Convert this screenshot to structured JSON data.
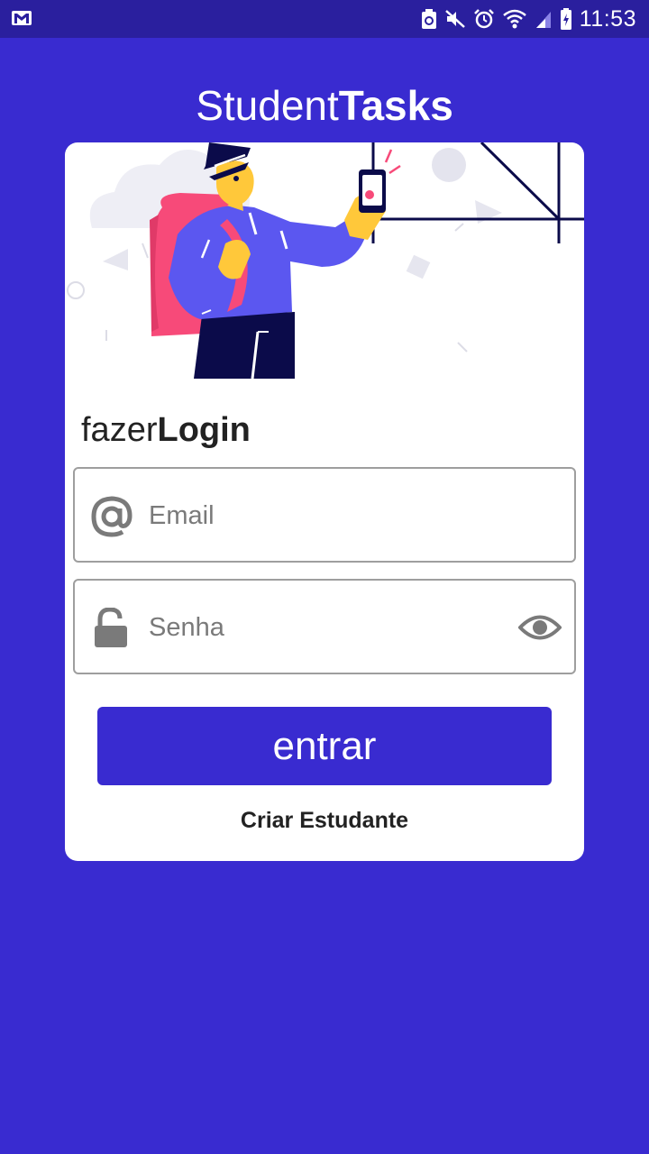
{
  "status_bar": {
    "time": "11:53",
    "left_icon": "gmail-icon",
    "right_icons": [
      "recycle-icon",
      "mute-icon",
      "alarm-icon",
      "wifi-icon",
      "signal-icon",
      "battery-icon"
    ]
  },
  "header": {
    "title_light": "Student",
    "title_bold": "Tasks"
  },
  "login": {
    "heading_light": "fazer",
    "heading_bold": "Login",
    "email": {
      "placeholder": "Email",
      "value": "",
      "icon": "at-icon"
    },
    "password": {
      "placeholder": "Senha",
      "value": "",
      "icon": "unlock-icon",
      "toggle_icon": "eye-icon"
    },
    "submit_label": "entrar",
    "create_label": "Criar Estudante"
  },
  "colors": {
    "background": "#392bd0",
    "status_bar": "#2a1f9e",
    "card": "#ffffff",
    "primary_button": "#392bd0",
    "input_border": "#9e9e9e",
    "icon_gray": "#7a7a7a"
  }
}
